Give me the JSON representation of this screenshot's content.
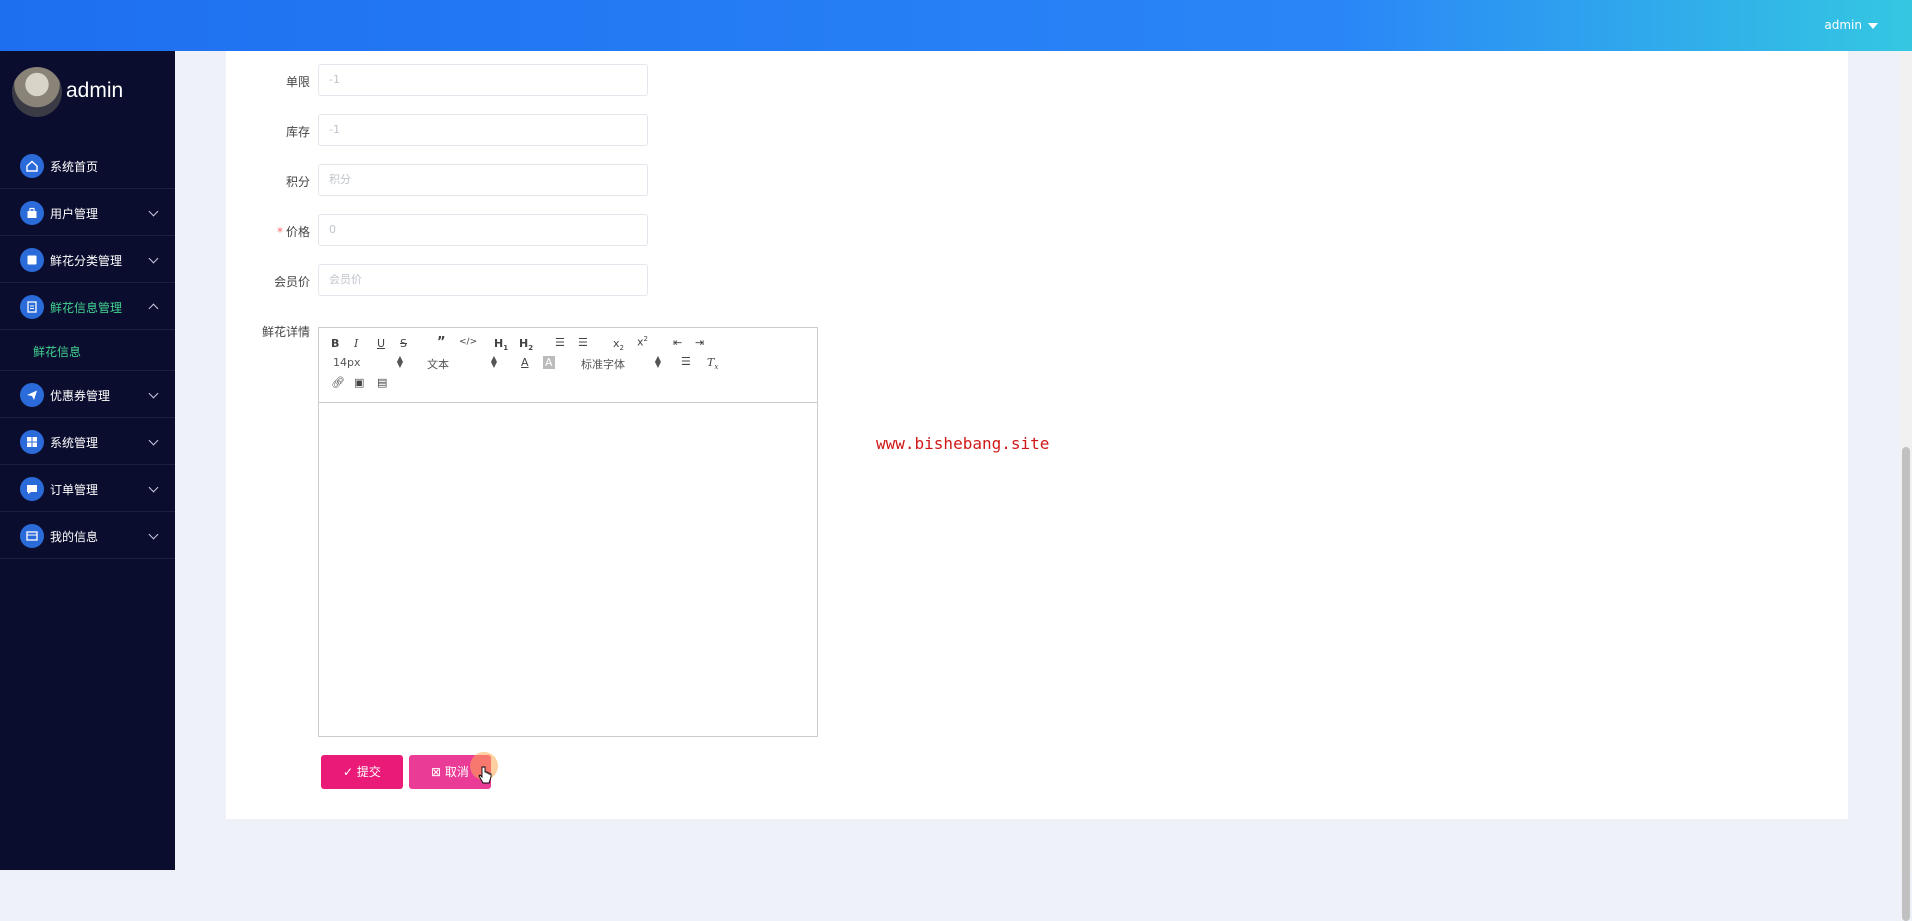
{
  "header": {
    "user_label": "admin"
  },
  "sidebar": {
    "profile_name": "admin",
    "items": [
      {
        "label": "系统首页",
        "icon": "home-icon",
        "has_children": false
      },
      {
        "label": "用户管理",
        "icon": "user-icon",
        "has_children": true
      },
      {
        "label": "鲜花分类管理",
        "icon": "category-icon",
        "has_children": true
      },
      {
        "label": "鲜花信息管理",
        "icon": "info-icon",
        "has_children": true,
        "expanded": true,
        "active": true
      },
      {
        "label": "优惠券管理",
        "icon": "coupon-icon",
        "has_children": true
      },
      {
        "label": "系统管理",
        "icon": "grid-icon",
        "has_children": true
      },
      {
        "label": "订单管理",
        "icon": "order-icon",
        "has_children": true
      },
      {
        "label": "我的信息",
        "icon": "profile-icon",
        "has_children": true
      }
    ],
    "submenu": {
      "label": "鲜花信息"
    }
  },
  "form": {
    "fields": [
      {
        "label": "单限",
        "value": "-1",
        "required": false
      },
      {
        "label": "库存",
        "value": "-1",
        "required": false
      },
      {
        "label": "积分",
        "placeholder": "积分",
        "required": false
      },
      {
        "label": "价格",
        "value": "0",
        "required": true
      },
      {
        "label": "会员价",
        "placeholder": "会员价",
        "required": false
      }
    ],
    "editor_label": "鲜花详情",
    "editor": {
      "font_size": "14px",
      "text_style": "文本",
      "font_family": "标准字体",
      "content": ""
    },
    "submit_label": "提交",
    "cancel_label": "取消"
  },
  "watermark": "www.bishebang.site",
  "colors": {
    "topbar_start": "#1e6ff0",
    "topbar_end": "#34c7e2",
    "sidebar_bg": "#0b0d2e",
    "active_text": "#42d392",
    "submit_btn": "#ea1b78",
    "cancel_btn": "#ea3c96",
    "watermark": "#d01818"
  }
}
